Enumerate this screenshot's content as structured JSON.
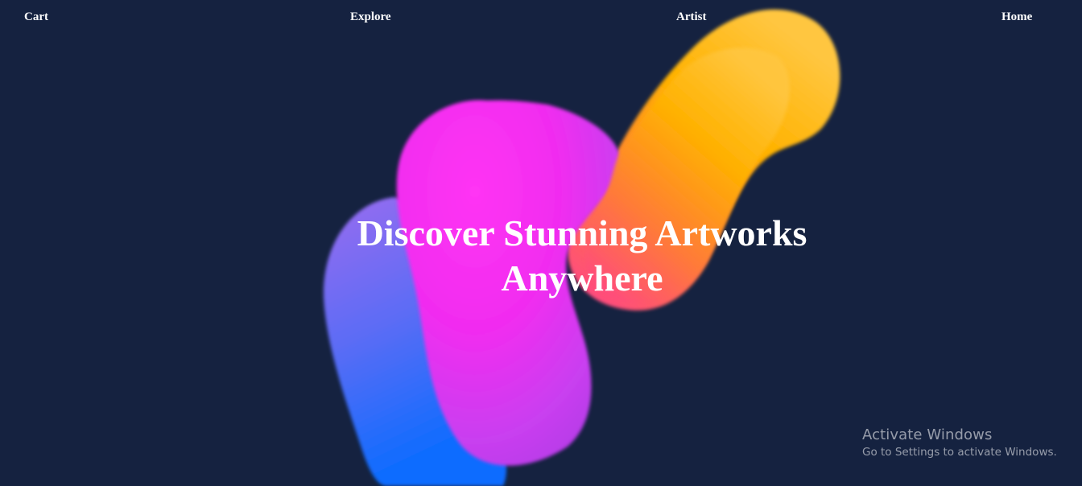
{
  "nav": {
    "cart": "Cart",
    "explore": "Explore",
    "artist": "Artist",
    "home": "Home"
  },
  "hero": {
    "heading": "Discover Stunning Artworks Anywhere"
  },
  "watermark": {
    "title": "Activate Windows",
    "subtitle": "Go to Settings to activate Windows."
  },
  "colors": {
    "background": "#152240",
    "text": "#ffffff",
    "blob_orange": "#ffb000",
    "blob_magenta": "#f020f0",
    "blob_blue": "#0a6cff"
  }
}
